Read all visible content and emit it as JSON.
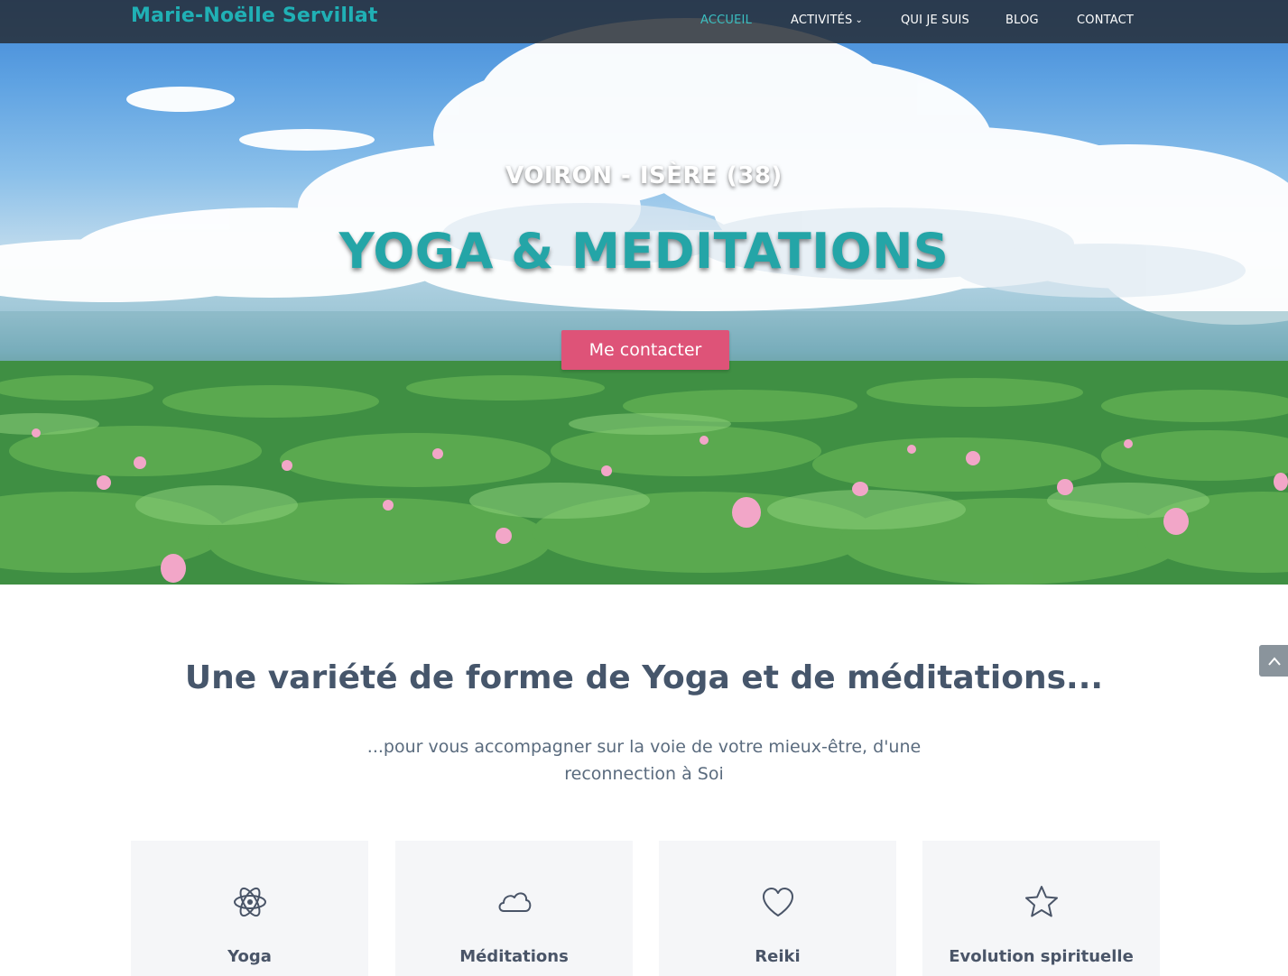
{
  "header": {
    "brand": "Marie-Noëlle Servillat",
    "nav": [
      {
        "label": "ACCUEIL",
        "active": true
      },
      {
        "label": "ACTIVITÉS",
        "has_dropdown": true
      },
      {
        "label": "QUI JE SUIS"
      },
      {
        "label": "BLOG"
      },
      {
        "label": "CONTACT"
      }
    ],
    "dropdown_icon": "chevron-down-icon"
  },
  "hero": {
    "subtitle": "VOIRON - ISÈRE (38)",
    "title": "YOGA & MEDITATIONS",
    "cta_label": "Me contacter",
    "background": "lotus-field-sky-clouds"
  },
  "intro": {
    "title": "Une variété de forme de Yoga et de méditations...",
    "subtitle": "...pour vous accompagner sur la voie de votre mieux-être, d'une reconnection à Soi"
  },
  "cards": [
    {
      "icon": "atom-icon",
      "label": "Yoga"
    },
    {
      "icon": "cloud-icon",
      "label": "Méditations"
    },
    {
      "icon": "heart-icon",
      "label": "Reiki"
    },
    {
      "icon": "star-icon",
      "label": "Evolution spirituelle"
    }
  ],
  "scroll_top_icon": "chevron-up-icon",
  "colors": {
    "accent": "#24a5a7",
    "nav_active": "#3bbfc1",
    "button": "#de5378",
    "navbar_bg": "#262c34",
    "heading": "#46566b",
    "card_bg": "#f5f6f8"
  }
}
